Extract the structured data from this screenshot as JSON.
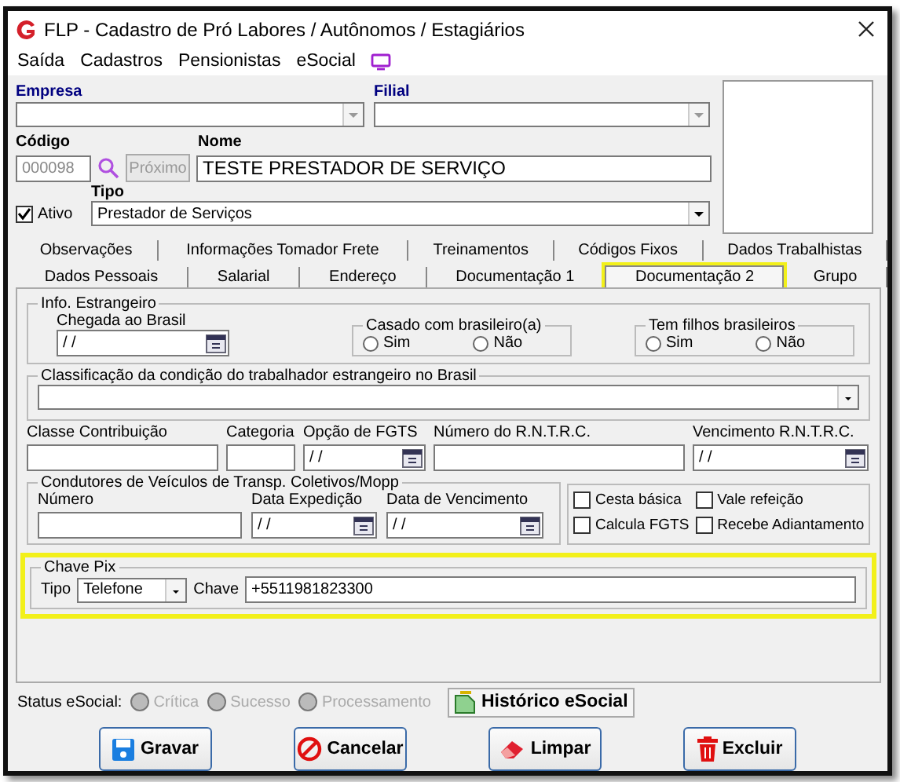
{
  "window": {
    "title": "FLP - Cadastro de Pró Labores / Autônomos / Estagiários"
  },
  "menu": [
    "Saída",
    "Cadastros",
    "Pensionistas",
    "eSocial"
  ],
  "header": {
    "empresa_label": "Empresa",
    "filial_label": "Filial",
    "codigo_label": "Código",
    "codigo_value": "000098",
    "next_button": "Próximo",
    "nome_label": "Nome",
    "nome_value": "TESTE PRESTADOR DE SERVIÇO",
    "ativo": {
      "label": "Ativo",
      "checked": true
    },
    "tipo_label": "Tipo",
    "tipo_value": "Prestador de Serviços"
  },
  "tabs_row_1": [
    {
      "label": "Observações",
      "selected": false
    },
    {
      "label": "Informações Tomador Frete",
      "selected": false
    },
    {
      "label": "Treinamentos",
      "selected": false
    },
    {
      "label": "Códigos Fixos",
      "selected": false
    },
    {
      "label": "Dados Trabalhistas",
      "selected": false
    }
  ],
  "tabs_row_2": [
    {
      "label": "Dados Pessoais",
      "selected": false,
      "highlighted": false
    },
    {
      "label": "Salarial",
      "selected": false,
      "highlighted": false
    },
    {
      "label": "Endereço",
      "selected": false,
      "highlighted": false
    },
    {
      "label": "Documentação 1",
      "selected": false,
      "highlighted": false
    },
    {
      "label": "Documentação 2",
      "selected": true,
      "highlighted": true
    },
    {
      "label": "Grupo",
      "selected": false,
      "highlighted": false
    }
  ],
  "info_estrangeiro": {
    "title": "Info. Estrangeiro",
    "chegada_label": "Chegada ao Brasil",
    "chegada_value": "/ /",
    "groups": [
      {
        "title": "Casado com brasileiro(a)",
        "options": [
          {
            "label": "Sim",
            "selected": false
          },
          {
            "label": "Não",
            "selected": false
          }
        ]
      },
      {
        "title": "Tem filhos brasileiros",
        "options": [
          {
            "label": "Sim",
            "selected": false
          },
          {
            "label": "Não",
            "selected": false
          }
        ]
      }
    ]
  },
  "classificacao": {
    "title": "Classificação da condição do trabalhador estrangeiro no Brasil"
  },
  "fields": [
    {
      "label": "Classe Contribuição",
      "kind": "text"
    },
    {
      "label": "Categoria",
      "kind": "text"
    },
    {
      "label": "Opção de FGTS",
      "kind": "date",
      "value": "/ /"
    },
    {
      "label": "Número do R.N.T.R.C.",
      "kind": "text"
    },
    {
      "label": "Vencimento R.N.T.R.C.",
      "kind": "date",
      "value": "/ /"
    }
  ],
  "condutores": {
    "title": "Condutores de Veículos de Transp. Coletivos/Mopp",
    "fields": [
      {
        "label": "Número",
        "kind": "text"
      },
      {
        "label": "Data Expedição",
        "kind": "date",
        "value": "/ /"
      },
      {
        "label": "Data de Vencimento",
        "kind": "date",
        "value": "/ /"
      }
    ]
  },
  "checks": [
    {
      "label": "Cesta básica",
      "checked": false
    },
    {
      "label": "Vale refeição",
      "checked": false
    },
    {
      "label": "Calcula FGTS",
      "checked": false
    },
    {
      "label": "Recebe Adiantamento",
      "checked": false
    }
  ],
  "pix": {
    "title": "Chave Pix",
    "tipo_label": "Tipo",
    "tipo_value": "Telefone",
    "chave_label": "Chave",
    "chave_value": "+5511981823300",
    "highlighted": true
  },
  "status": {
    "label": "Status eSocial:",
    "items": [
      {
        "label": "Crítica",
        "disabled": true
      },
      {
        "label": "Sucesso",
        "disabled": true
      },
      {
        "label": "Processamento",
        "disabled": true
      }
    ],
    "history_button": "Histórico eSocial"
  },
  "buttons": [
    {
      "label": "Gravar",
      "kind": "save"
    },
    {
      "label": "Cancelar",
      "kind": "cancel"
    },
    {
      "label": "Limpar",
      "kind": "clear"
    },
    {
      "label": "Excluir",
      "kind": "delete"
    }
  ]
}
